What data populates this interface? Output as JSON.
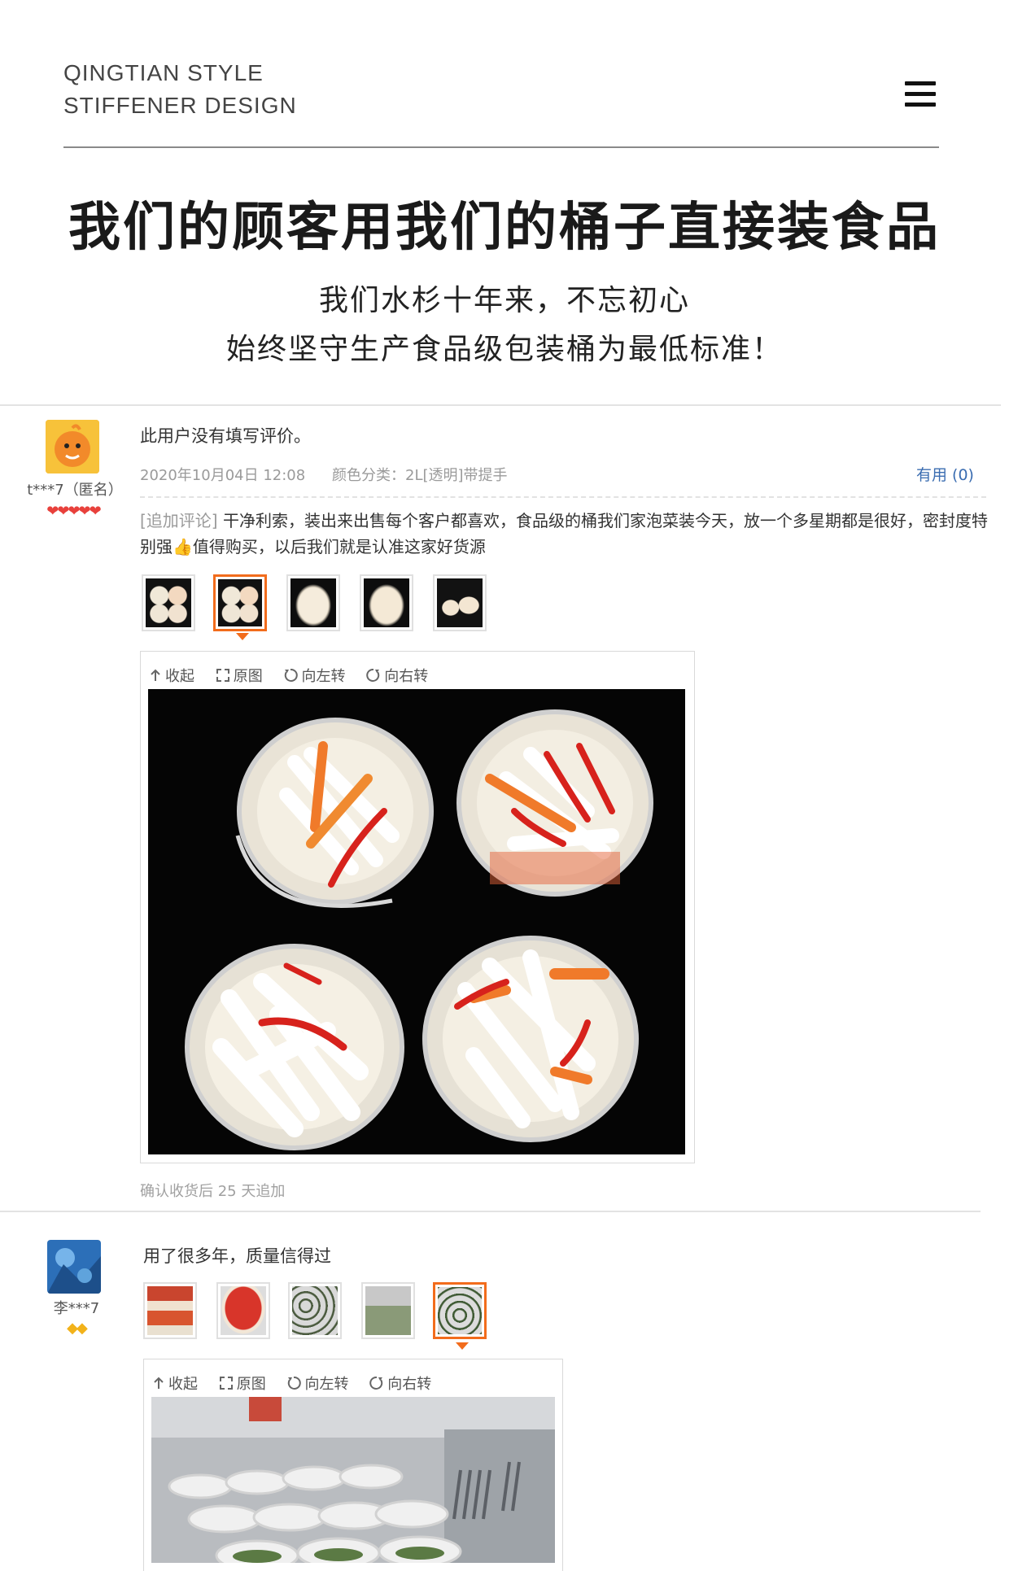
{
  "header": {
    "brand_line1": "QINGTIAN STYLE",
    "brand_line2": "STIFFENER DESIGN"
  },
  "banner": {
    "headline": "我们的顾客用我们的桶子直接装食品",
    "sub_line1": "我们水杉十年来，不忘初心",
    "sub_line2": "始终坚守生产食品级包装桶为最低标准！"
  },
  "reviews": [
    {
      "username": "t***7（匿名）",
      "badges": "❤❤❤❤❤",
      "text": "此用户没有填写评价。",
      "date": "2020年10月04日 12:08",
      "variant": "颜色分类：2L[透明]带提手",
      "useful": "有用 (0)",
      "append_tag": "[追加评论]",
      "append_text": "干净利索，装出来出售每个客户都喜欢，食品级的桶我们家泡菜装今天，放一个多星期都是很好，密封度特别强👍值得购买，以后我们就是认准这家好货源",
      "footnote": "确认收货后 25 天追加",
      "thumbs_selected": 2
    },
    {
      "username": "李***7",
      "badges": "◆◆",
      "text": "用了很多年，质量信得过",
      "thumbs_selected": 5
    }
  ],
  "viewer_tools": {
    "collapse": "收起",
    "original": "原图",
    "rotate_left": "向左转",
    "rotate_right": "向右转"
  },
  "colors": {
    "accent": "#f26c1c",
    "link": "#3b6db1",
    "badge": "#e8403b"
  }
}
